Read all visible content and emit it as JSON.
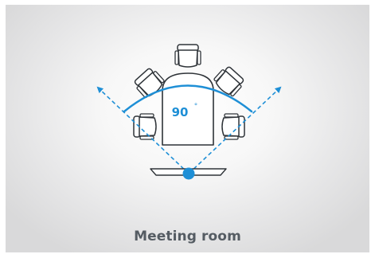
{
  "diagram": {
    "angle_value": "90",
    "degree_symbol": "°",
    "caption": "Meeting room",
    "colors": {
      "accent": "#1e8fd6",
      "furniture_fill": "#ffffff",
      "furniture_stroke": "#2e3338",
      "caption_text": "#555c63",
      "background_center": "#ffffff",
      "background_edge": "#d9d9da"
    },
    "icons": [
      "chair-icon",
      "meeting-table-icon",
      "camera-icon",
      "camera-mount-icon",
      "arrow-icon"
    ]
  }
}
